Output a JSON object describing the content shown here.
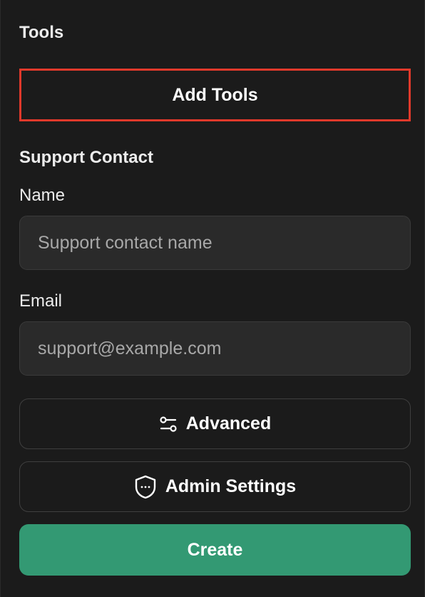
{
  "tools": {
    "heading": "Tools",
    "add_button_label": "Add Tools"
  },
  "support_contact": {
    "heading": "Support Contact",
    "name": {
      "label": "Name",
      "value": "",
      "placeholder": "Support contact name"
    },
    "email": {
      "label": "Email",
      "value": "",
      "placeholder": "support@example.com"
    }
  },
  "actions": {
    "advanced_label": "Advanced",
    "advanced_icon": "sliders-icon",
    "admin_settings_label": "Admin Settings",
    "admin_settings_icon": "shield-icon",
    "create_label": "Create"
  },
  "colors": {
    "background": "#1b1b1b",
    "primary": "#339973",
    "highlight_border": "#e0392b",
    "input_background": "#2a2a2a"
  }
}
